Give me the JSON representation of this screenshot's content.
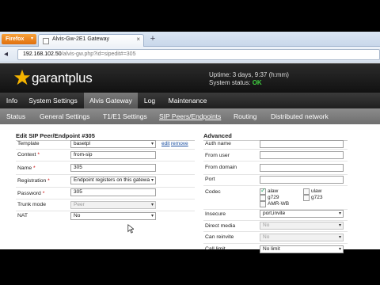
{
  "browser": {
    "menu_label": "Firefox",
    "tab_title": "Alvis-Gw-2E1 Gateway",
    "tab_close": "×",
    "new_tab": "+",
    "url_host": "192.168.102.50",
    "url_path": "/alvis-gw.php?id=sipedit#=305"
  },
  "header": {
    "logo_text": "garantplus",
    "uptime_line": "Uptime: 3 days, 9:37 (h:mm)",
    "status_label": "System status: ",
    "status_value": "OK",
    "status_color": "#3fcf3f",
    "brand_color": "#f5b400"
  },
  "main_menu": [
    "Info",
    "System Settings",
    "Alvis Gateway",
    "Log",
    "Maintenance"
  ],
  "main_menu_active": "Alvis Gateway",
  "sub_menu": [
    "Status",
    "General Settings",
    "T1/E1 Settings",
    "SIP Peers/Endpoints",
    "Routing",
    "Distributed network"
  ],
  "sub_menu_active": "SIP Peers/Endpoints",
  "edit": {
    "title": "Edit SIP Peer/Endpoint #305",
    "required_mark": "*",
    "edit_link": "edit",
    "remove_link": "remove",
    "fields": {
      "template": {
        "label": "Template",
        "value": "basetpl"
      },
      "context": {
        "label": "Context",
        "value": "from-sip"
      },
      "name": {
        "label": "Name",
        "value": "305"
      },
      "registration": {
        "label": "Registration",
        "value": "Endpoint registers on this gatewa"
      },
      "password": {
        "label": "Password",
        "value": "305"
      },
      "trunk_mode": {
        "label": "Trunk mode",
        "value": "Peer"
      },
      "nat": {
        "label": "NAT",
        "value": "No"
      }
    }
  },
  "advanced": {
    "title": "Advanced",
    "fields": {
      "auth_name": {
        "label": "Auth name",
        "value": ""
      },
      "from_user": {
        "label": "From user",
        "value": ""
      },
      "from_domain": {
        "label": "From domain",
        "value": ""
      },
      "port": {
        "label": "Port",
        "value": ""
      },
      "codec": {
        "label": "Codec"
      },
      "insecure": {
        "label": "Insecure",
        "value": "port,invite"
      },
      "direct_media": {
        "label": "Direct media",
        "value": "No"
      },
      "can_reinvite": {
        "label": "Can reinvite",
        "value": "No"
      },
      "call_limit": {
        "label": "Call limit",
        "value": "No limit"
      }
    },
    "codecs": [
      {
        "name": "alaw",
        "checked": true
      },
      {
        "name": "ulaw",
        "checked": false
      },
      {
        "name": "g729",
        "checked": false
      },
      {
        "name": "g723",
        "checked": false
      },
      {
        "name": "AMR-WB",
        "checked": false
      }
    ]
  },
  "dropdown_glyph": "▾",
  "back_glyph": "◂",
  "cursor_icon": "mouse-pointer"
}
